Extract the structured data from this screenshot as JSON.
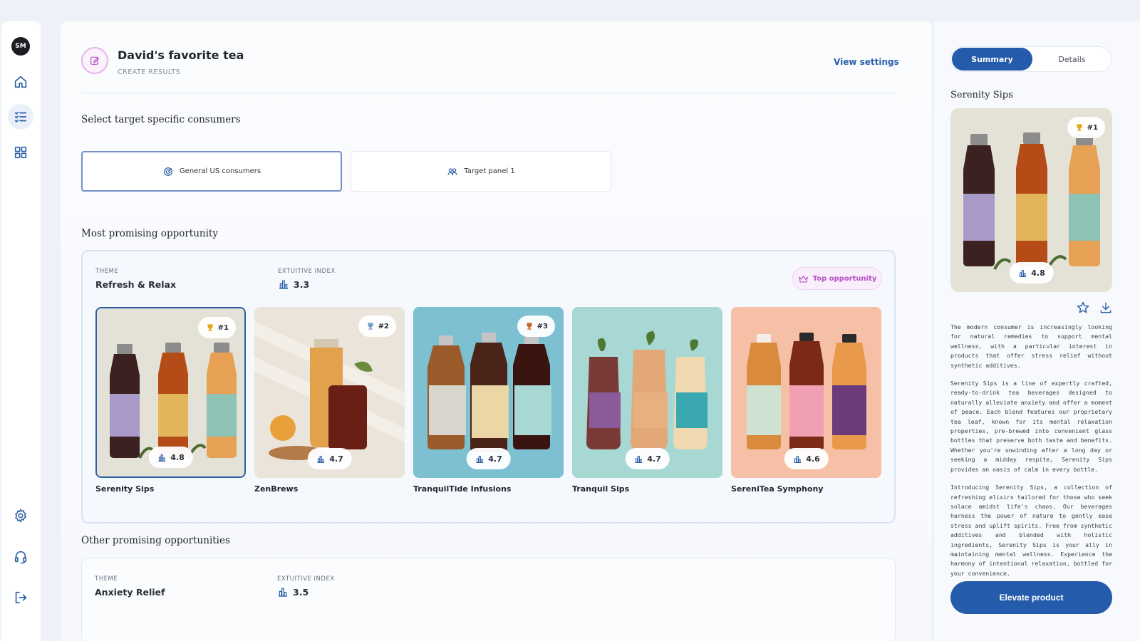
{
  "sidebar": {
    "avatar_initials": "SM",
    "nav_icons": [
      "home-icon",
      "checklist-icon",
      "grid-icon",
      "gear-icon",
      "headset-icon",
      "logout-icon"
    ]
  },
  "header": {
    "title": "David's favorite tea",
    "subtitle": "CREATE RESULTS",
    "view_settings": "View settings"
  },
  "consumers": {
    "heading": "Select target specific consumers",
    "options": [
      {
        "label": "General US consumers",
        "selected": true,
        "icon": "target-icon"
      },
      {
        "label": "Target panel 1",
        "selected": false,
        "icon": "people-icon"
      }
    ]
  },
  "most_promising": {
    "heading": "Most promising opportunity",
    "theme_label": "THEME",
    "theme_value": "Refresh & Relax",
    "index_label": "EXTUITIVE INDEX",
    "index_value": "3.3",
    "badge": "Top opportunity",
    "products": [
      {
        "name": "Serenity Sips",
        "rank": "#1",
        "score": "4.8",
        "selected": true
      },
      {
        "name": "ZenBrews",
        "rank": "#2",
        "score": "4.7",
        "selected": false
      },
      {
        "name": "TranquilTide Infusions",
        "rank": "#3",
        "score": "4.7",
        "selected": false
      },
      {
        "name": "Tranquil Sips",
        "rank": "",
        "score": "4.7",
        "selected": false
      },
      {
        "name": "SereniTea Symphony",
        "rank": "",
        "score": "4.6",
        "selected": false
      }
    ]
  },
  "other": {
    "heading": "Other promising opportunities",
    "theme_label": "THEME",
    "theme_value": "Anxiety Relief",
    "index_label": "EXTUITIVE INDEX",
    "index_value": "3.5"
  },
  "right_panel": {
    "tabs": [
      "Summary",
      "Details"
    ],
    "active_tab": "Summary",
    "title": "Serenity Sips",
    "rank": "#1",
    "score": "4.8",
    "paragraphs": [
      "The modern consumer is increasingly looking for natural remedies to support mental wellness, with a particular interest in products that offer stress relief without synthetic additives.",
      "Serenity Sips is a line of expertly crafted, ready-to-drink tea beverages designed to naturally alleviate anxiety and offer a moment of peace. Each blend features our proprietary tea leaf, known for its mental relaxation properties, pre-brewed into convenient glass bottles that preserve both taste and benefits. Whether you're unwinding after a long day or seeking a midday respite, Serenity Sips provides an oasis of calm in every bottle.",
      "Introducing Serenity Sips, a collection of refreshing elixirs tailored for those who seek solace amidst life's chaos. Our beverages harness the power of nature to gently ease stress and uplift spirits. Free from synthetic additives and blended with holistic ingredients, Serenity Sips is your ally in maintaining mental wellness. Experience the harmony of intentional relaxation, bottled for your convenience."
    ],
    "cta": "Elevate product"
  },
  "colors": {
    "primary": "#245bab",
    "accent_pink": "#b353c2",
    "rank_gold": "#e8a317",
    "rank_silver": "#7a9cc6",
    "rank_bronze": "#c8652a"
  }
}
